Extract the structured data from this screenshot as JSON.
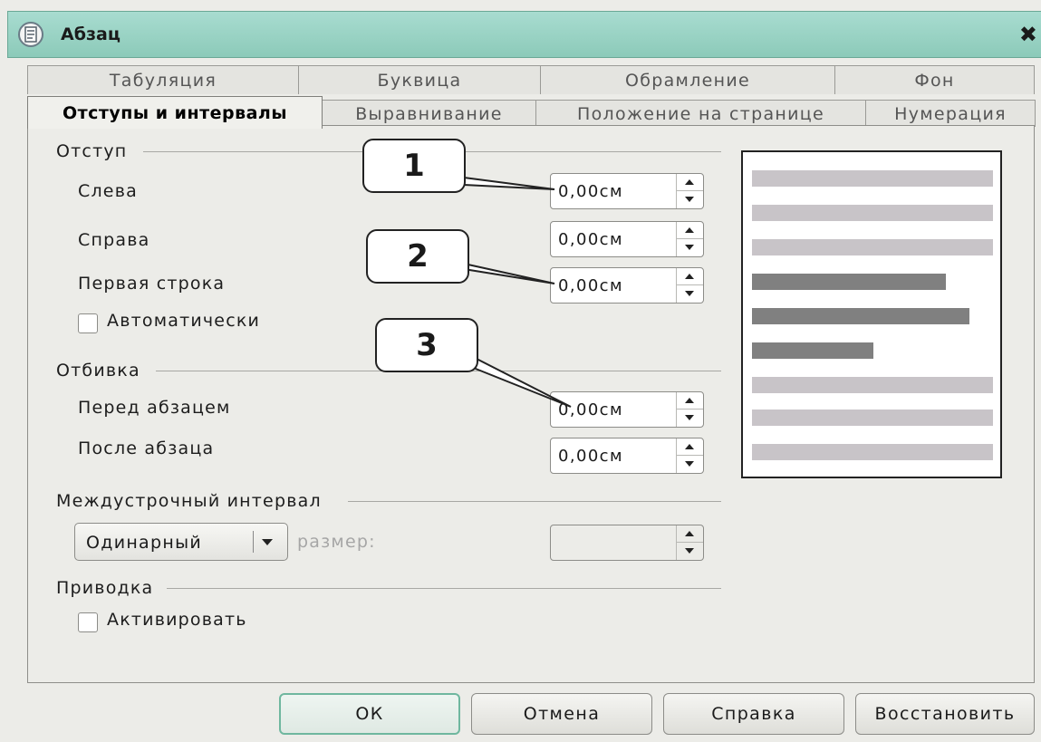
{
  "window": {
    "title": "Абзац",
    "icon": "paragraph-dialog-icon",
    "close": "✖"
  },
  "tabs_top": [
    "Табуляция",
    "Буквица",
    "Обрамление",
    "Фон"
  ],
  "tabs_bottom": [
    "Отступы и интервалы",
    "Выравнивание",
    "Положение на странице",
    "Нумерация"
  ],
  "active_tab": "Отступы и интервалы",
  "indent": {
    "section": "Отступ",
    "left": {
      "label": "Слева",
      "value": "0,00см"
    },
    "right": {
      "label": "Справа",
      "value": "0,00см"
    },
    "first_line": {
      "label": "Первая строка",
      "value": "0,00см"
    },
    "auto": {
      "label": "Автоматически",
      "checked": false
    }
  },
  "spacing": {
    "section": "Отбивка",
    "before": {
      "label": "Перед абзацем",
      "value": "0,00см"
    },
    "after": {
      "label": "После абзаца",
      "value": "0,00см"
    }
  },
  "line_spacing": {
    "section": "Междустрочный интервал",
    "mode": "Одинарный",
    "size_label": "размер:",
    "size_value": ""
  },
  "register": {
    "section": "Приводка",
    "activate": {
      "label": "Активировать",
      "checked": false
    }
  },
  "callouts": [
    "1",
    "2",
    "3"
  ],
  "preview": {
    "light_color": "#c8c4c8",
    "dark_color": "#808080"
  },
  "buttons": {
    "ok": "ОК",
    "cancel": "Отмена",
    "help": "Справка",
    "reset": "Восстановить"
  }
}
